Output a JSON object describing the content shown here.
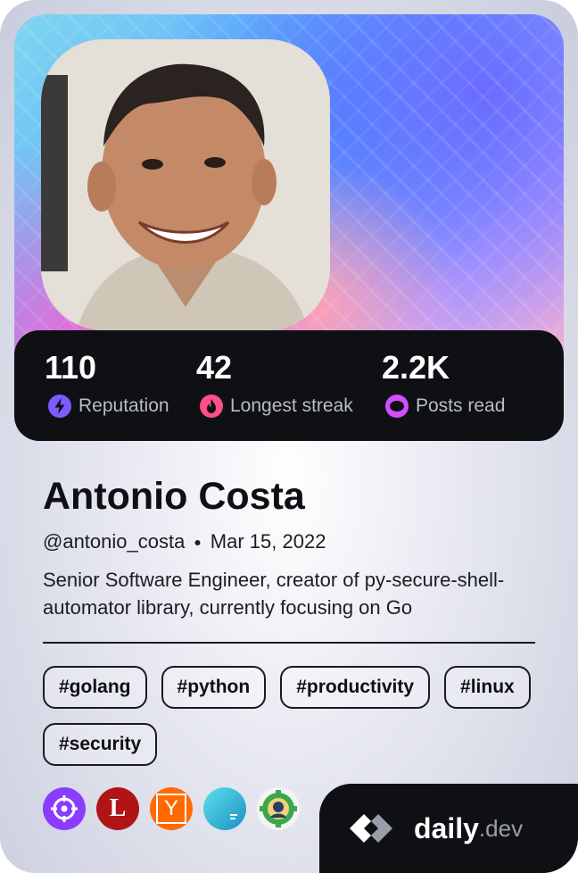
{
  "profile": {
    "name": "Antonio Costa",
    "handle": "@antonio_costa",
    "joined": "Mar 15, 2022",
    "bio": "Senior Software Engineer, creator of py-secure-shell-automator library, currently focusing on Go"
  },
  "stats": [
    {
      "value": "110",
      "label": "Reputation",
      "icon": "bolt-icon",
      "color": "#7c5cff"
    },
    {
      "value": "42",
      "label": "Longest streak",
      "icon": "flame-icon",
      "color": "#ff4f8a"
    },
    {
      "value": "2.2K",
      "label": "Posts read",
      "icon": "eye-icon",
      "color": "#d24dff"
    }
  ],
  "tags": [
    "#golang",
    "#python",
    "#productivity",
    "#linux",
    "#security"
  ],
  "squads": [
    {
      "icon": "crosshair-icon",
      "bg": "#8a3cff"
    },
    {
      "icon": "letter-l-icon",
      "bg": "#b01414",
      "text": "L"
    },
    {
      "icon": "letter-y-icon",
      "bg": "#ff6a00",
      "text": "Y"
    },
    {
      "icon": "aqua-icon",
      "bg": "#29c4dc"
    },
    {
      "icon": "gear-avatar-icon",
      "bg": "#f4f4f4"
    }
  ],
  "brand": {
    "daily": "daily",
    "dev": ".dev"
  }
}
